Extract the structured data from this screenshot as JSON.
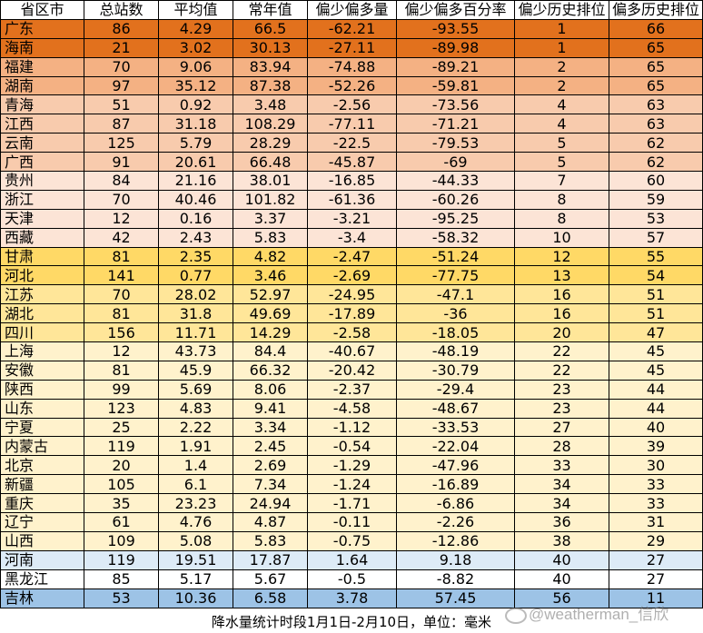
{
  "headers": [
    "省区市",
    "总站数",
    "平均值",
    "常年值",
    "偏少偏多量",
    "偏少偏多百分率",
    "偏少历史排位",
    "偏多历史排位"
  ],
  "rows": [
    {
      "cells": [
        "广东",
        "86",
        "4.29",
        "66.5",
        "-62.21",
        "-93.55",
        "1",
        "66"
      ],
      "color": "#e2711d"
    },
    {
      "cells": [
        "海南",
        "21",
        "3.02",
        "30.13",
        "-27.11",
        "-89.98",
        "1",
        "65"
      ],
      "color": "#e2711d"
    },
    {
      "cells": [
        "福建",
        "70",
        "9.06",
        "83.94",
        "-74.88",
        "-89.21",
        "2",
        "65"
      ],
      "color": "#f4b183"
    },
    {
      "cells": [
        "湖南",
        "97",
        "35.12",
        "87.38",
        "-52.26",
        "-59.81",
        "2",
        "65"
      ],
      "color": "#f4b183"
    },
    {
      "cells": [
        "青海",
        "51",
        "0.92",
        "3.48",
        "-2.56",
        "-73.56",
        "4",
        "63"
      ],
      "color": "#f8cbad"
    },
    {
      "cells": [
        "江西",
        "87",
        "31.18",
        "108.29",
        "-77.11",
        "-71.21",
        "4",
        "63"
      ],
      "color": "#f8cbad"
    },
    {
      "cells": [
        "云南",
        "125",
        "5.79",
        "28.29",
        "-22.5",
        "-79.53",
        "5",
        "62"
      ],
      "color": "#f8cbad"
    },
    {
      "cells": [
        "广西",
        "91",
        "20.61",
        "66.48",
        "-45.87",
        "-69",
        "5",
        "62"
      ],
      "color": "#f8cbad"
    },
    {
      "cells": [
        "贵州",
        "84",
        "21.16",
        "38.01",
        "-16.85",
        "-44.33",
        "7",
        "60"
      ],
      "color": "#fce4d6"
    },
    {
      "cells": [
        "浙江",
        "70",
        "40.46",
        "101.82",
        "-61.36",
        "-60.26",
        "8",
        "59"
      ],
      "color": "#fce4d6"
    },
    {
      "cells": [
        "天津",
        "12",
        "0.16",
        "3.37",
        "-3.21",
        "-95.25",
        "8",
        "53"
      ],
      "color": "#fce4d6"
    },
    {
      "cells": [
        "西藏",
        "42",
        "2.43",
        "5.83",
        "-3.4",
        "-58.32",
        "10",
        "57"
      ],
      "color": "#fce4d6"
    },
    {
      "cells": [
        "甘肃",
        "81",
        "2.35",
        "4.82",
        "-2.47",
        "-51.24",
        "12",
        "55"
      ],
      "color": "#ffd966"
    },
    {
      "cells": [
        "河北",
        "141",
        "0.77",
        "3.46",
        "-2.69",
        "-77.75",
        "13",
        "54"
      ],
      "color": "#ffd966"
    },
    {
      "cells": [
        "江苏",
        "70",
        "28.02",
        "52.97",
        "-24.95",
        "-47.1",
        "16",
        "51"
      ],
      "color": "#ffe699"
    },
    {
      "cells": [
        "湖北",
        "81",
        "31.8",
        "49.69",
        "-17.89",
        "-36",
        "16",
        "51"
      ],
      "color": "#ffe699"
    },
    {
      "cells": [
        "四川",
        "156",
        "11.71",
        "14.29",
        "-2.58",
        "-18.05",
        "20",
        "47"
      ],
      "color": "#ffe699"
    },
    {
      "cells": [
        "上海",
        "12",
        "43.73",
        "84.4",
        "-40.67",
        "-48.19",
        "22",
        "45"
      ],
      "color": "#fff2cc"
    },
    {
      "cells": [
        "安徽",
        "81",
        "45.9",
        "66.32",
        "-20.42",
        "-30.79",
        "22",
        "45"
      ],
      "color": "#fff2cc"
    },
    {
      "cells": [
        "陕西",
        "99",
        "5.69",
        "8.06",
        "-2.37",
        "-29.4",
        "23",
        "44"
      ],
      "color": "#fff2cc"
    },
    {
      "cells": [
        "山东",
        "123",
        "4.83",
        "9.41",
        "-4.58",
        "-48.67",
        "23",
        "44"
      ],
      "color": "#fff2cc"
    },
    {
      "cells": [
        "宁夏",
        "25",
        "2.22",
        "3.34",
        "-1.12",
        "-33.53",
        "27",
        "40"
      ],
      "color": "#fff2cc"
    },
    {
      "cells": [
        "内蒙古",
        "119",
        "1.91",
        "2.45",
        "-0.54",
        "-22.04",
        "28",
        "39"
      ],
      "color": "#fff2cc"
    },
    {
      "cells": [
        "北京",
        "20",
        "1.4",
        "2.69",
        "-1.29",
        "-47.96",
        "33",
        "30"
      ],
      "color": "#fff2cc"
    },
    {
      "cells": [
        "新疆",
        "105",
        "6.1",
        "7.34",
        "-1.24",
        "-16.89",
        "34",
        "33"
      ],
      "color": "#fff2cc"
    },
    {
      "cells": [
        "重庆",
        "35",
        "23.23",
        "24.94",
        "-1.71",
        "-6.86",
        "34",
        "33"
      ],
      "color": "#fff2cc"
    },
    {
      "cells": [
        "辽宁",
        "61",
        "4.76",
        "4.87",
        "-0.11",
        "-2.26",
        "36",
        "31"
      ],
      "color": "#fff2cc"
    },
    {
      "cells": [
        "山西",
        "109",
        "5.08",
        "5.83",
        "-0.75",
        "-12.86",
        "38",
        "29"
      ],
      "color": "#fff2cc"
    },
    {
      "cells": [
        "河南",
        "119",
        "19.51",
        "17.87",
        "1.64",
        "9.18",
        "40",
        "27"
      ],
      "color": "#ddebf7"
    },
    {
      "cells": [
        "黑龙江",
        "85",
        "5.17",
        "5.67",
        "-0.5",
        "-8.82",
        "40",
        "27"
      ],
      "color": "#ffffff"
    },
    {
      "cells": [
        "吉林",
        "53",
        "10.36",
        "6.58",
        "3.78",
        "57.45",
        "56",
        "11"
      ],
      "color": "#9dc3e6"
    }
  ],
  "footer": "降水量统计时段1月1日-2月10日，单位：毫米",
  "watermark": "@weatherman_信欣"
}
